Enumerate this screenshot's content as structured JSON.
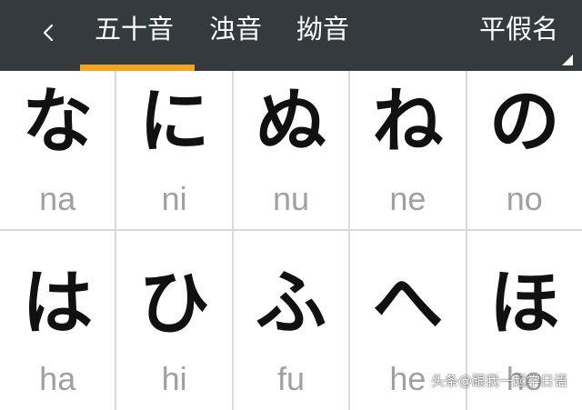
{
  "header": {
    "tabs": [
      {
        "label": "五十音",
        "active": true
      },
      {
        "label": "浊音",
        "active": false
      },
      {
        "label": "拗音",
        "active": false
      }
    ],
    "kana_type": "平假名",
    "accent_color": "#f3a522",
    "background_color": "#353a3f",
    "back_icon": "chevron-left-icon"
  },
  "grid": {
    "rows": [
      [
        {
          "kana": "な",
          "romaji": "na"
        },
        {
          "kana": "に",
          "romaji": "ni"
        },
        {
          "kana": "ぬ",
          "romaji": "nu"
        },
        {
          "kana": "ね",
          "romaji": "ne"
        },
        {
          "kana": "の",
          "romaji": "no"
        }
      ],
      [
        {
          "kana": "は",
          "romaji": "ha"
        },
        {
          "kana": "ひ",
          "romaji": "hi"
        },
        {
          "kana": "ふ",
          "romaji": "fu"
        },
        {
          "kana": "へ",
          "romaji": "he"
        },
        {
          "kana": "ほ",
          "romaji": "ho"
        }
      ]
    ]
  },
  "watermark": "头条@跟我一起学日语"
}
